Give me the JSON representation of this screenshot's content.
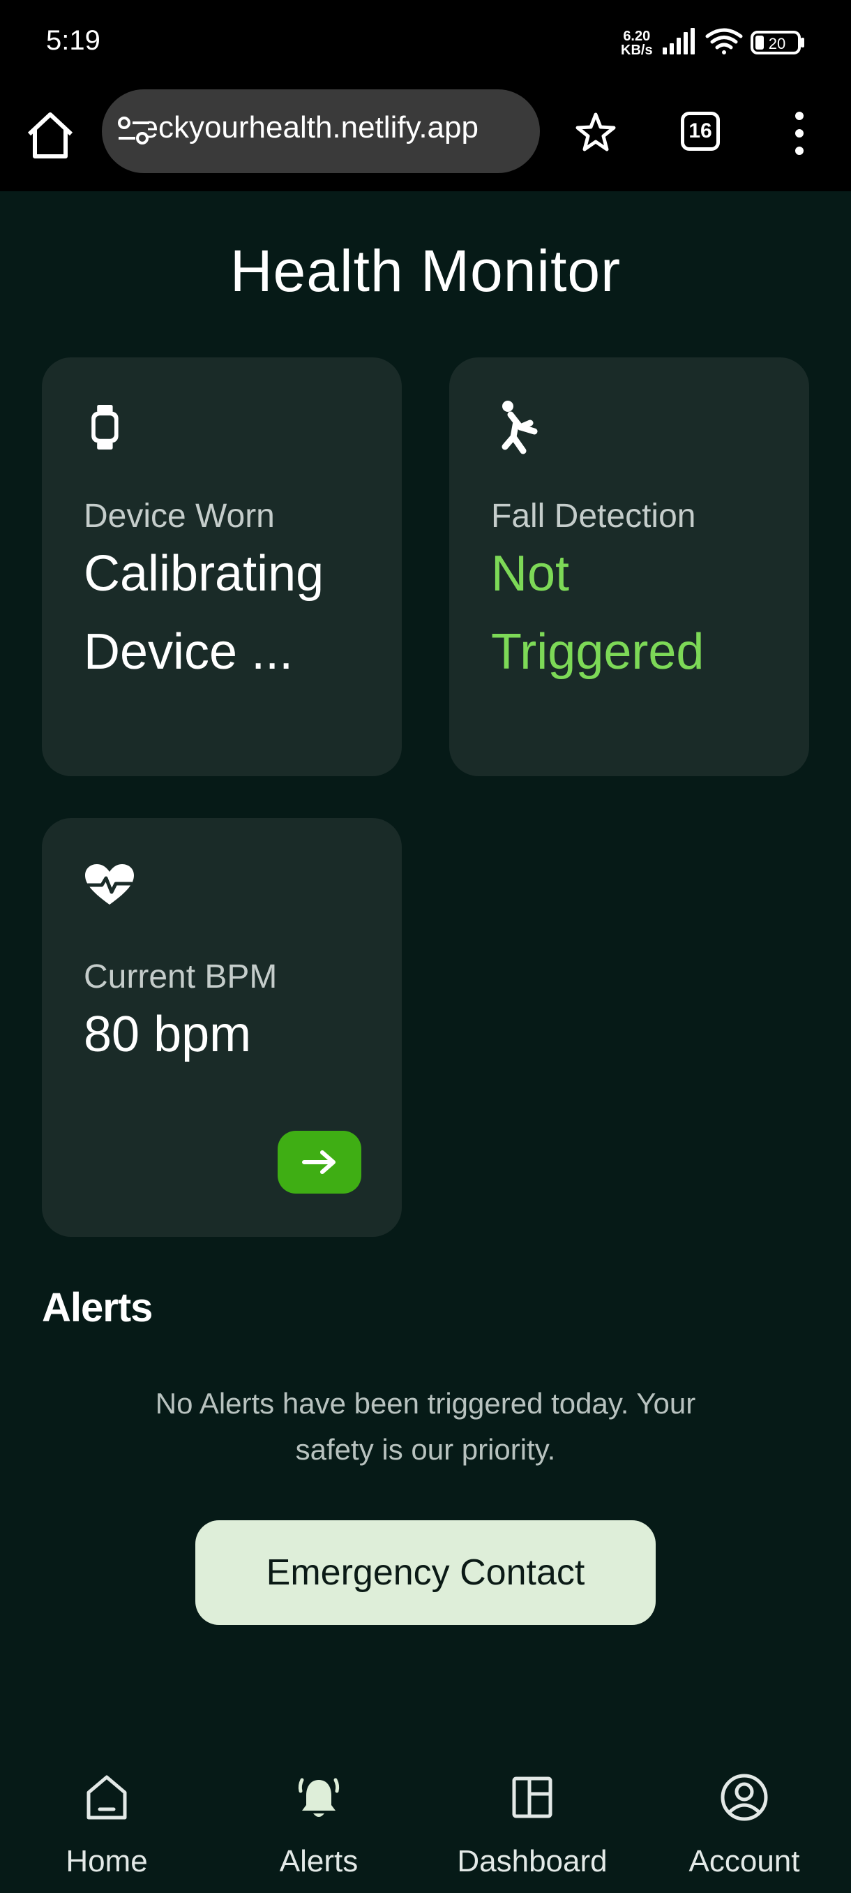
{
  "status_bar": {
    "time": "5:19",
    "speed_value": "6.20",
    "speed_unit": "KB/s",
    "battery": "20"
  },
  "browser": {
    "url": "checkyourhealth.netlify.app",
    "tab_count": "16"
  },
  "page": {
    "title": "Health Monitor"
  },
  "cards": {
    "device": {
      "icon": "watch-icon",
      "label": "Device Worn",
      "value_line1": "Calibrating",
      "value_line2": "Device ..."
    },
    "fall": {
      "icon": "falling-person-icon",
      "label": "Fall Detection",
      "value_line1": "Not",
      "value_line2": "Triggered",
      "value_color": "#7dd957"
    },
    "bpm": {
      "icon": "heart-pulse-icon",
      "label": "Current BPM",
      "value": "80 bpm",
      "action_icon": "arrow-right-icon"
    }
  },
  "alerts": {
    "heading": "Alerts",
    "message_line1": "No Alerts have been triggered today. Your",
    "message_line2": "safety is our priority."
  },
  "emergency_button": "Emergency Contact",
  "nav": {
    "items": [
      {
        "label": "Home",
        "icon": "home-icon"
      },
      {
        "label": "Alerts",
        "icon": "bell-ringing-icon",
        "active": true
      },
      {
        "label": "Dashboard",
        "icon": "dashboard-icon"
      },
      {
        "label": "Account",
        "icon": "account-circle-icon"
      }
    ]
  },
  "colors": {
    "background": "#061a17",
    "card": "#1a2b28",
    "accent_green": "#3fae14",
    "status_green": "#7dd957",
    "emergency_bg": "#deeed9"
  }
}
